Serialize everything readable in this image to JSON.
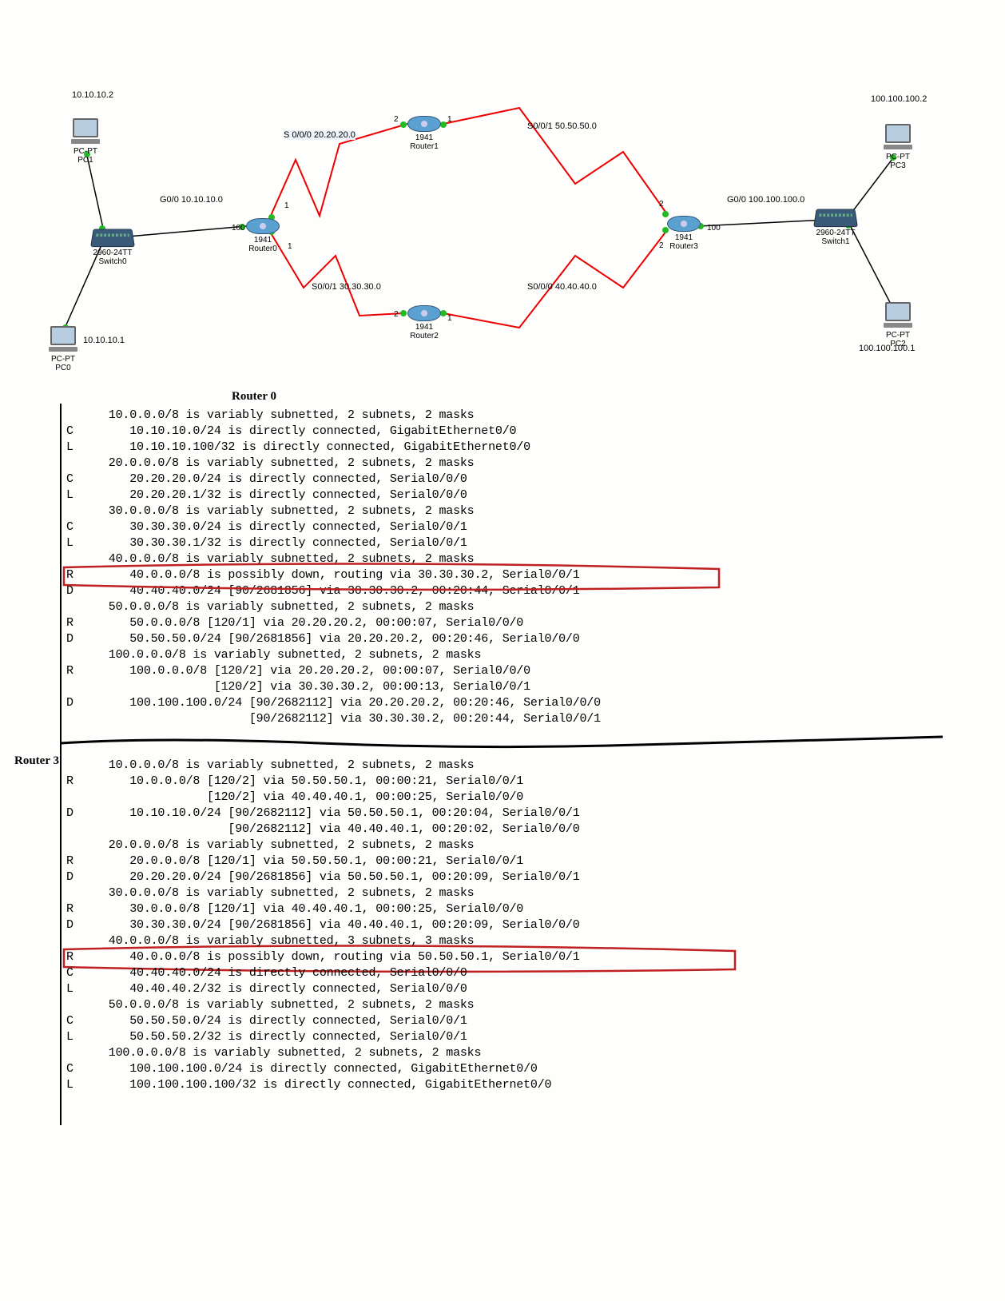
{
  "topology": {
    "devices": {
      "pc1": {
        "type": "PC-PT",
        "name": "PC1",
        "ip": "10.10.10.2"
      },
      "pc0": {
        "type": "PC-PT",
        "name": "PC0",
        "ip": "10.10.10.1"
      },
      "pc3": {
        "type": "PC-PT",
        "name": "PC3",
        "ip": "100.100.100.2"
      },
      "pc2": {
        "type": "PC-PT",
        "name": "PC2",
        "ip": "100.100.100.1"
      },
      "sw0": {
        "type": "2960-24TT",
        "name": "Switch0"
      },
      "sw1": {
        "type": "2960-24TT",
        "name": "Switch1"
      },
      "r0": {
        "type": "1941",
        "name": "Router0"
      },
      "r1": {
        "type": "1941",
        "name": "Router1"
      },
      "r2": {
        "type": "1941",
        "name": "Router2"
      },
      "r3": {
        "type": "1941",
        "name": "Router3"
      }
    },
    "links": {
      "sw0_r0": {
        "label": "G0/0 10.10.10.0",
        "port_sw": "",
        "port_r": "100"
      },
      "r0_r1": {
        "label": "S 0/0/0 20.20.20.0",
        "p_r0": "1",
        "p_r1": "2"
      },
      "r0_r2": {
        "label": "S0/0/1 30.30.30.0",
        "p_r0": "1",
        "p_r2": "2"
      },
      "r1_r3": {
        "label": "S0/0/1 50.50.50.0",
        "p_r1": "1",
        "p_r3": "2"
      },
      "r2_r3": {
        "label": "S0/0/0 40.40.40.0",
        "p_r2": "1",
        "p_r3": "2"
      },
      "r3_sw1": {
        "label": "G0/0 100.100.100.0",
        "port_r": "100"
      }
    }
  },
  "router0": {
    "header": "Router 0",
    "lines": [
      {
        "code": "",
        "text": "     10.0.0.0/8 is variably subnetted, 2 subnets, 2 masks"
      },
      {
        "code": "C",
        "text": "        10.10.10.0/24 is directly connected, GigabitEthernet0/0"
      },
      {
        "code": "L",
        "text": "        10.10.10.100/32 is directly connected, GigabitEthernet0/0"
      },
      {
        "code": "",
        "text": "     20.0.0.0/8 is variably subnetted, 2 subnets, 2 masks"
      },
      {
        "code": "C",
        "text": "        20.20.20.0/24 is directly connected, Serial0/0/0"
      },
      {
        "code": "L",
        "text": "        20.20.20.1/32 is directly connected, Serial0/0/0"
      },
      {
        "code": "",
        "text": "     30.0.0.0/8 is variably subnetted, 2 subnets, 2 masks"
      },
      {
        "code": "C",
        "text": "        30.30.30.0/24 is directly connected, Serial0/0/1"
      },
      {
        "code": "L",
        "text": "        30.30.30.1/32 is directly connected, Serial0/0/1"
      },
      {
        "code": "",
        "text": "     40.0.0.0/8 is variably subnetted, 2 subnets, 2 masks"
      },
      {
        "code": "R",
        "text": "        40.0.0.0/8 is possibly down, routing via 30.30.30.2, Serial0/0/1"
      },
      {
        "code": "D",
        "text": "        40.40.40.0/24 [90/2681856] via 30.30.30.2, 00:20:44, Serial0/0/1"
      },
      {
        "code": "",
        "text": "     50.0.0.0/8 is variably subnetted, 2 subnets, 2 masks"
      },
      {
        "code": "R",
        "text": "        50.0.0.0/8 [120/1] via 20.20.20.2, 00:00:07, Serial0/0/0"
      },
      {
        "code": "D",
        "text": "        50.50.50.0/24 [90/2681856] via 20.20.20.2, 00:20:46, Serial0/0/0"
      },
      {
        "code": "",
        "text": "     100.0.0.0/8 is variably subnetted, 2 subnets, 2 masks"
      },
      {
        "code": "R",
        "text": "        100.0.0.0/8 [120/2] via 20.20.20.2, 00:00:07, Serial0/0/0"
      },
      {
        "code": "",
        "text": "                    [120/2] via 30.30.30.2, 00:00:13, Serial0/0/1"
      },
      {
        "code": "D",
        "text": "        100.100.100.0/24 [90/2682112] via 20.20.20.2, 00:20:46, Serial0/0/0"
      },
      {
        "code": "",
        "text": "                         [90/2682112] via 30.30.30.2, 00:20:44, Serial0/0/1"
      }
    ]
  },
  "router3": {
    "header": "Router 3",
    "lines": [
      {
        "code": "",
        "text": "     10.0.0.0/8 is variably subnetted, 2 subnets, 2 masks"
      },
      {
        "code": "R",
        "text": "        10.0.0.0/8 [120/2] via 50.50.50.1, 00:00:21, Serial0/0/1"
      },
      {
        "code": "",
        "text": "                   [120/2] via 40.40.40.1, 00:00:25, Serial0/0/0"
      },
      {
        "code": "D",
        "text": "        10.10.10.0/24 [90/2682112] via 50.50.50.1, 00:20:04, Serial0/0/1"
      },
      {
        "code": "",
        "text": "                      [90/2682112] via 40.40.40.1, 00:20:02, Serial0/0/0"
      },
      {
        "code": "",
        "text": "     20.0.0.0/8 is variably subnetted, 2 subnets, 2 masks"
      },
      {
        "code": "R",
        "text": "        20.0.0.0/8 [120/1] via 50.50.50.1, 00:00:21, Serial0/0/1"
      },
      {
        "code": "D",
        "text": "        20.20.20.0/24 [90/2681856] via 50.50.50.1, 00:20:09, Serial0/0/1"
      },
      {
        "code": "",
        "text": "     30.0.0.0/8 is variably subnetted, 2 subnets, 2 masks"
      },
      {
        "code": "R",
        "text": "        30.0.0.0/8 [120/1] via 40.40.40.1, 00:00:25, Serial0/0/0"
      },
      {
        "code": "D",
        "text": "        30.30.30.0/24 [90/2681856] via 40.40.40.1, 00:20:09, Serial0/0/0"
      },
      {
        "code": "",
        "text": "     40.0.0.0/8 is variably subnetted, 3 subnets, 3 masks"
      },
      {
        "code": "R",
        "text": "        40.0.0.0/8 is possibly down, routing via 50.50.50.1, Serial0/0/1"
      },
      {
        "code": "C",
        "text": "        40.40.40.0/24 is directly connected, Serial0/0/0"
      },
      {
        "code": "L",
        "text": "        40.40.40.2/32 is directly connected, Serial0/0/0"
      },
      {
        "code": "",
        "text": "     50.0.0.0/8 is variably subnetted, 2 subnets, 2 masks"
      },
      {
        "code": "C",
        "text": "        50.50.50.0/24 is directly connected, Serial0/0/1"
      },
      {
        "code": "L",
        "text": "        50.50.50.2/32 is directly connected, Serial0/0/1"
      },
      {
        "code": "",
        "text": "     100.0.0.0/8 is variably subnetted, 2 subnets, 2 masks"
      },
      {
        "code": "C",
        "text": "        100.100.100.0/24 is directly connected, GigabitEthernet0/0"
      },
      {
        "code": "L",
        "text": "        100.100.100.100/32 is directly connected, GigabitEthernet0/0"
      }
    ]
  },
  "highlight_color": "#c02020"
}
